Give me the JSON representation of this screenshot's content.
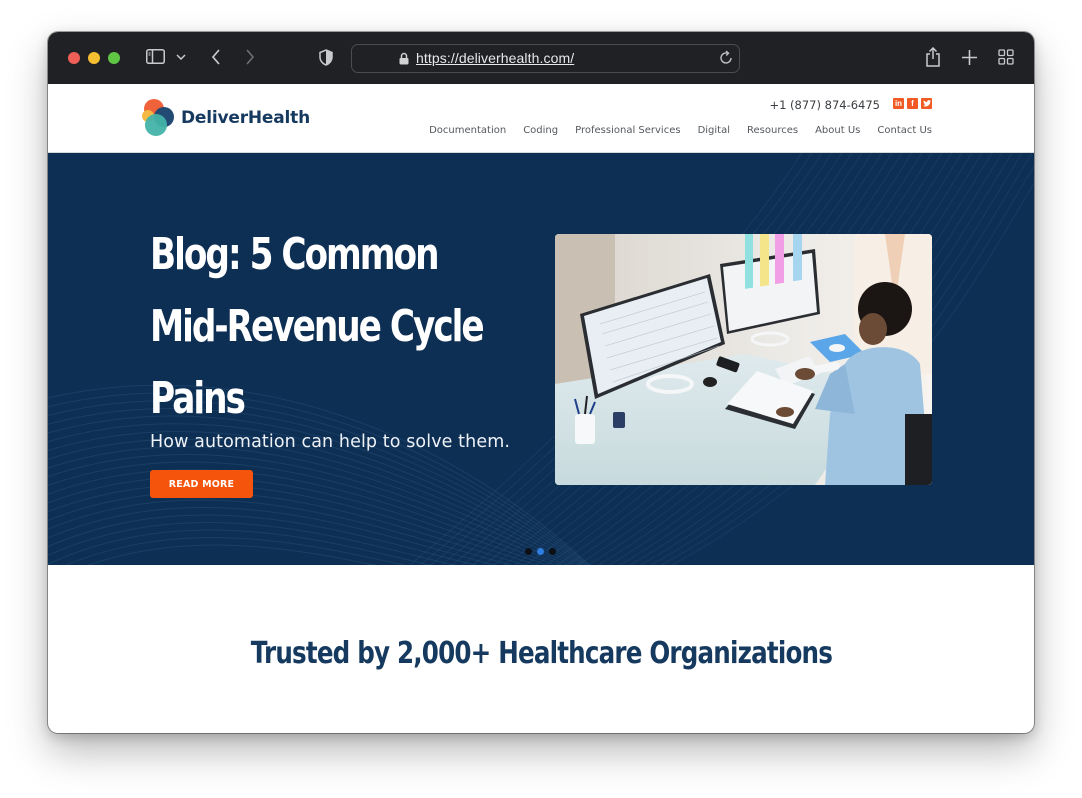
{
  "browser": {
    "url": "https://deliverhealth.com/",
    "icons": [
      "sidebar-icon",
      "chevron-down-icon",
      "back-icon",
      "forward-icon",
      "shield-icon",
      "lock-icon",
      "reload-icon",
      "share-icon",
      "plus-icon",
      "tabs-grid-icon"
    ]
  },
  "header": {
    "logo_text": "DeliverHealth",
    "phone": "+1 (877) 874-6475",
    "socials": [
      {
        "name": "linkedin",
        "glyph": "in"
      },
      {
        "name": "facebook",
        "glyph": "f"
      },
      {
        "name": "twitter",
        "glyph": "t"
      }
    ],
    "nav": [
      "Documentation",
      "Coding",
      "Professional Services",
      "Digital",
      "Resources",
      "About Us",
      "Contact Us"
    ]
  },
  "hero": {
    "title_lines": [
      "Blog: 5 Common",
      "Mid-Revenue Cycle",
      "Pains"
    ],
    "subtitle": "How automation can help to solve them.",
    "cta": "READ MORE",
    "image_alt": "Healthcare worker at desk reviewing spreadsheets on two monitors",
    "slides_total": 3,
    "slide_active": 2
  },
  "section": {
    "trusted_heading": "Trusted by 2,000+ Healthcare Organizations"
  },
  "colors": {
    "hero_bg": "#0e2f54",
    "brand_navy": "#163a5f",
    "accent_orange": "#f4540c",
    "dot_active": "#2e7de0"
  }
}
